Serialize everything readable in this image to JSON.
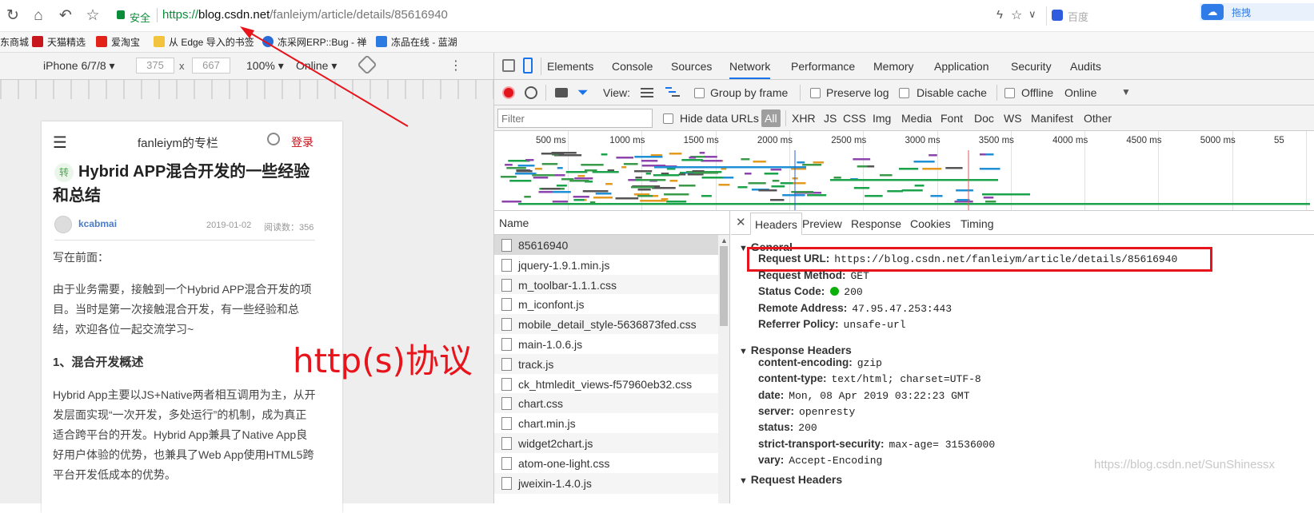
{
  "browser": {
    "secure_label": "安全",
    "url_https": "https://",
    "url_host": "blog.csdn.net",
    "url_path": "/fanleiym/article/details/85616940",
    "search_engine": "百度",
    "ext_label": "拖拽"
  },
  "bookmarks": [
    {
      "label": "东商城",
      "color": "#d33"
    },
    {
      "label": "天猫精选",
      "color": "#c8161d"
    },
    {
      "label": "爱淘宝",
      "color": "#e2231a"
    },
    {
      "label": "从 Edge 导入的书签",
      "color": "#f2c33c"
    },
    {
      "label": "冻采网ERP::Bug - 禅",
      "color": "#2a6bd8"
    },
    {
      "label": "冻品在线 - 蓝湖",
      "color": "#2b7be2"
    }
  ],
  "device_toolbar": {
    "device": "iPhone 6/7/8",
    "width": "375",
    "times": "x",
    "height": "667",
    "zoom": "100%",
    "network": "Online"
  },
  "page": {
    "header_title": "fanleiym的专栏",
    "login": "登录",
    "badge": "转",
    "title": "Hybrid APP混合开发的一些经验和总结",
    "author": "kcabmai",
    "date": "2019-01-02",
    "reads": "阅读数：356",
    "intro_heading": "写在前面：",
    "para1": "由于业务需要，接触到一个Hybrid APP混合开发的项目。当时是第一次接触混合开发，有一些经验和总结，欢迎各位一起交流学习~",
    "section1": "1、混合开发概述",
    "para2": "Hybrid App主要以JS+Native两者相互调用为主，从开发层面实现“一次开发，多处运行”的机制，成为真正适合跨平台的开发。Hybrid App兼具了Native App良好用户体验的优势，也兼具了Web App使用HTML5跨平台开发低成本的优势。"
  },
  "annotation": {
    "text": "http(s)协议",
    "color": "#e8141b"
  },
  "devtools": {
    "tabs": [
      "Elements",
      "Console",
      "Sources",
      "Network",
      "Performance",
      "Memory",
      "Application",
      "Security",
      "Audits"
    ],
    "active_tab": "Network",
    "view_label": "View:",
    "group_by_frame": "Group by frame",
    "preserve_log": "Preserve log",
    "disable_cache": "Disable cache",
    "offline": "Offline",
    "throttle": "Online",
    "filter_placeholder": "Filter",
    "hide_data_urls": "Hide data URLs",
    "filters": [
      "All",
      "XHR",
      "JS",
      "CSS",
      "Img",
      "Media",
      "Font",
      "Doc",
      "WS",
      "Manifest",
      "Other"
    ],
    "timeline_ticks": [
      "500 ms",
      "1000 ms",
      "1500 ms",
      "2000 ms",
      "2500 ms",
      "3000 ms",
      "3500 ms",
      "4000 ms",
      "4500 ms",
      "5000 ms",
      "55"
    ],
    "name_header": "Name",
    "requests": [
      "85616940",
      "jquery-1.9.1.min.js",
      "m_toolbar-1.1.1.css",
      "m_iconfont.js",
      "mobile_detail_style-5636873fed.css",
      "main-1.0.6.js",
      "track.js",
      "ck_htmledit_views-f57960eb32.css",
      "chart.css",
      "chart.min.js",
      "widget2chart.js",
      "atom-one-light.css",
      "jweixin-1.4.0.js"
    ],
    "detail_tabs": [
      "Headers",
      "Preview",
      "Response",
      "Cookies",
      "Timing"
    ],
    "general_title": "General",
    "general": [
      {
        "k": "Request URL:",
        "v": "https://blog.csdn.net/fanleiym/article/details/85616940"
      },
      {
        "k": "Request Method:",
        "v": "GET"
      },
      {
        "k": "Status Code:",
        "v": "200"
      },
      {
        "k": "Remote Address:",
        "v": "47.95.47.253:443"
      },
      {
        "k": "Referrer Policy:",
        "v": "unsafe-url"
      }
    ],
    "response_title": "Response Headers",
    "response": [
      {
        "k": "content-encoding:",
        "v": "gzip"
      },
      {
        "k": "content-type:",
        "v": "text/html; charset=UTF-8"
      },
      {
        "k": "date:",
        "v": "Mon, 08 Apr 2019 03:22:23 GMT"
      },
      {
        "k": "server:",
        "v": "openresty"
      },
      {
        "k": "status:",
        "v": "200"
      },
      {
        "k": "strict-transport-security:",
        "v": "max-age= 31536000"
      },
      {
        "k": "vary:",
        "v": "Accept-Encoding"
      }
    ],
    "request_title": "Request Headers",
    "watermark": "https://blog.csdn.net/SunShinessx"
  }
}
